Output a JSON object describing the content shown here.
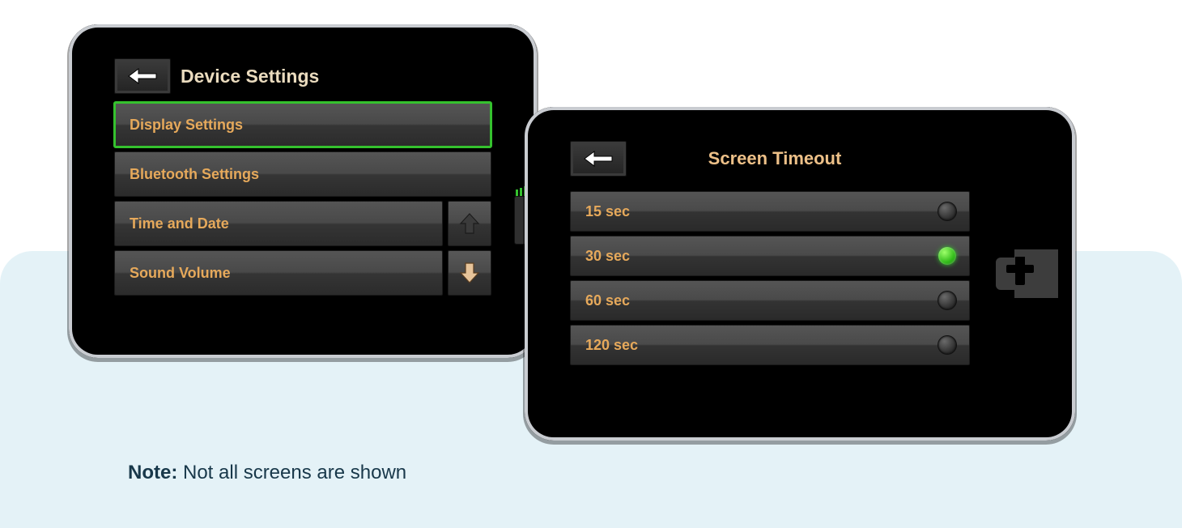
{
  "device1": {
    "title": "Device Settings",
    "menu": [
      {
        "label": "Display Settings",
        "selected": true
      },
      {
        "label": "Bluetooth Settings"
      },
      {
        "label": "Time and Date"
      },
      {
        "label": "Sound Volume"
      }
    ]
  },
  "device2": {
    "title": "Screen Timeout",
    "options": [
      {
        "label": "15 sec",
        "selected": false
      },
      {
        "label": "30 sec",
        "selected": true
      },
      {
        "label": "60 sec",
        "selected": false
      },
      {
        "label": "120 sec",
        "selected": false
      }
    ]
  },
  "note": {
    "prefix": "Note:",
    "text": " Not all screens are shown"
  }
}
